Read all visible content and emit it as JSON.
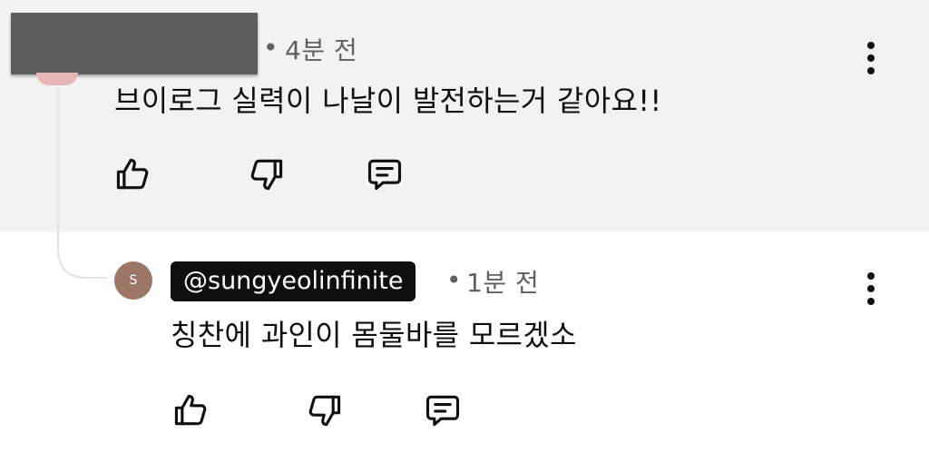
{
  "comment": {
    "time_sep": "•",
    "time": "4분 전",
    "text": "브이로그 실력이 나날이 발전하는거 같아요!!"
  },
  "reply": {
    "avatar_initial": "S",
    "handle": "@sungyeolinfinite",
    "time_sep": "•",
    "time": "1분 전",
    "text": "칭찬에 과인이 몸둘바를 모르겠소"
  },
  "icons": {
    "like": "thumbs-up-icon",
    "dislike": "thumbs-down-icon",
    "reply": "comment-reply-icon",
    "menu": "more-vertical-icon"
  },
  "colors": {
    "highlight_background": "#f2f2f2",
    "avatar": "#9c7666",
    "handle_chip": "#0f0f0f"
  }
}
